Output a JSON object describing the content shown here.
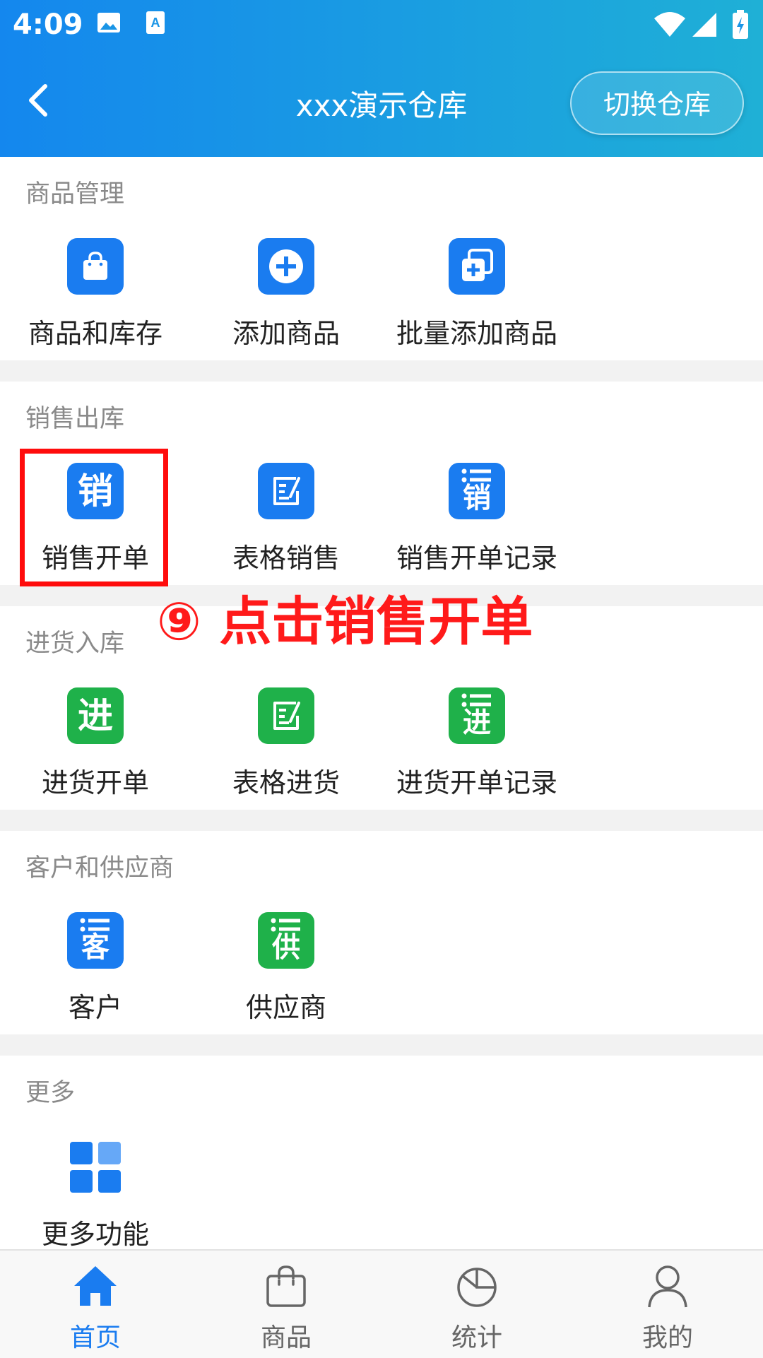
{
  "status_bar": {
    "time": "4:09"
  },
  "header": {
    "title": "xxx演示仓库",
    "switch_label": "切换仓库"
  },
  "sections": {
    "goods": {
      "title": "商品管理",
      "items": [
        "商品和库存",
        "添加商品",
        "批量添加商品"
      ]
    },
    "sales": {
      "title": "销售出库",
      "items": [
        "销售开单",
        "表格销售",
        "销售开单记录"
      ],
      "icon_chars": [
        "销",
        "销"
      ]
    },
    "purchase": {
      "title": "进货入库",
      "items": [
        "进货开单",
        "表格进货",
        "进货开单记录"
      ],
      "icon_chars": [
        "进",
        "进"
      ]
    },
    "partners": {
      "title": "客户和供应商",
      "items": [
        "客户",
        "供应商"
      ],
      "icon_chars": [
        "客",
        "供"
      ]
    },
    "more": {
      "title": "更多",
      "items": [
        "更多功能"
      ]
    }
  },
  "annotation": {
    "text": "⑨ 点击销售开单"
  },
  "bottom_nav": {
    "items": [
      "首页",
      "商品",
      "统计",
      "我的"
    ],
    "active": "首页"
  },
  "colors": {
    "accent": "#1a7cf0",
    "green": "#1fb14a",
    "annotation": "#ff1a1a"
  }
}
